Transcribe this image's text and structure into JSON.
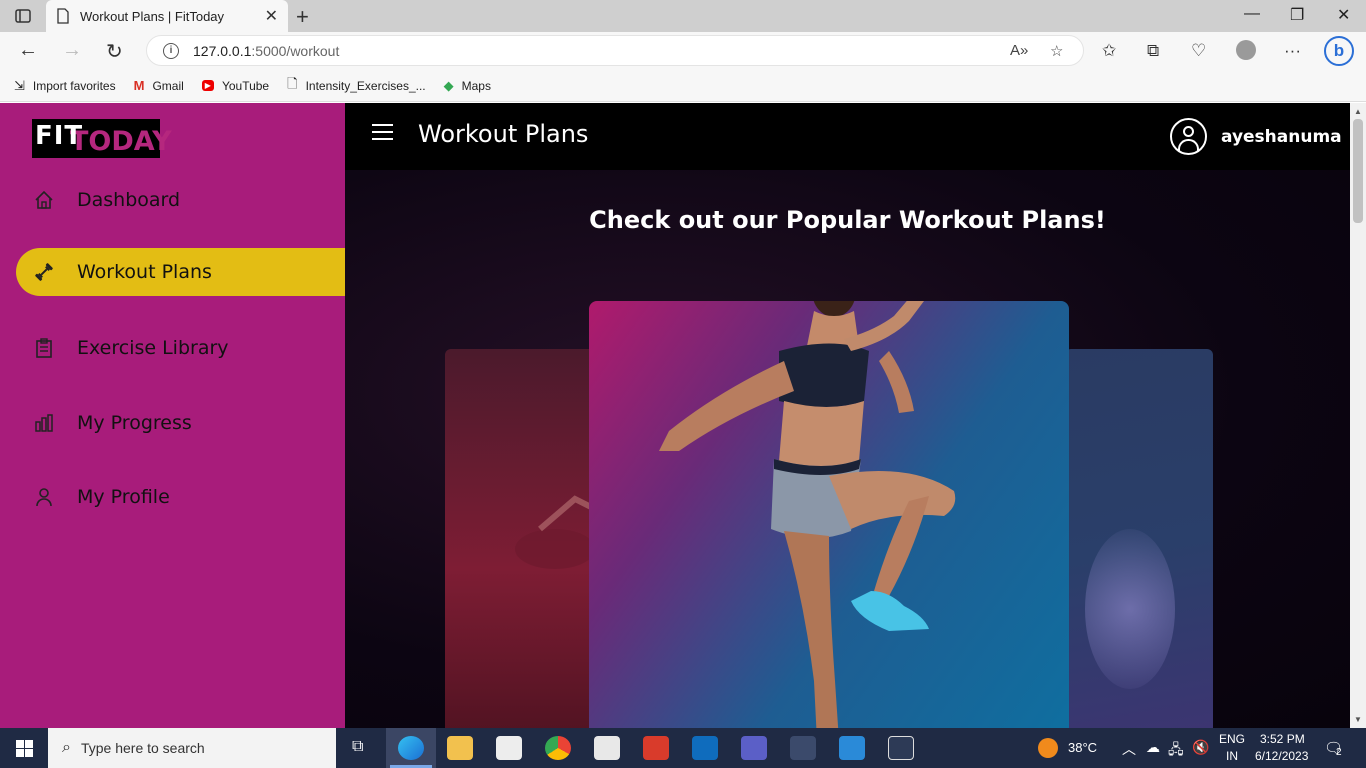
{
  "browser": {
    "tab_title": "Workout Plans | FitToday",
    "url_host": "127.0.0.1",
    "url_path": ":5000/workout",
    "bookmarks": [
      {
        "label": "Import favorites",
        "icon": "import-icon"
      },
      {
        "label": "Gmail",
        "icon": "gmail-icon"
      },
      {
        "label": "YouTube",
        "icon": "youtube-icon"
      },
      {
        "label": "Intensity_Exercises_...",
        "icon": "document-icon"
      },
      {
        "label": "Maps",
        "icon": "maps-icon"
      }
    ]
  },
  "app": {
    "logo_fit": "FIT",
    "logo_today": "TODAY",
    "header_title": "Workout Plans",
    "username": "ayeshanuma",
    "heading": "Check out our Popular Workout Plans!",
    "accent_color": "#e3bd14",
    "sidebar_color": "#a81c7b",
    "menu": [
      {
        "label": "Dashboard",
        "icon": "home-icon"
      },
      {
        "label": "Workout Plans",
        "icon": "dumbbell-icon",
        "active": true
      },
      {
        "label": "Exercise Library",
        "icon": "clipboard-icon"
      },
      {
        "label": "My Progress",
        "icon": "bar-chart-icon"
      },
      {
        "label": "My Profile",
        "icon": "user-icon"
      }
    ]
  },
  "taskbar": {
    "search_placeholder": "Type here to search",
    "temperature": "38°C",
    "lang_line1": "ENG",
    "lang_line2": "IN",
    "time": "3:52 PM",
    "date": "6/12/2023",
    "notifications": "2"
  }
}
